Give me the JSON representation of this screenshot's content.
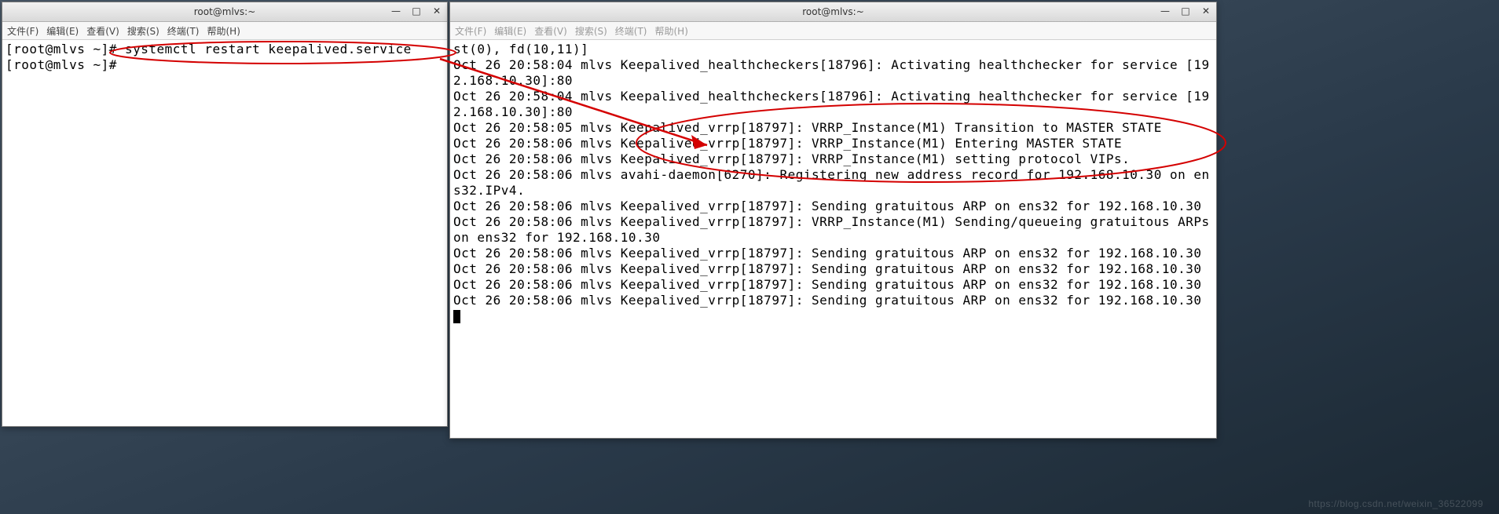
{
  "left_window": {
    "title": "root@mlvs:~",
    "menus": [
      "文件(F)",
      "编辑(E)",
      "查看(V)",
      "搜索(S)",
      "终端(T)",
      "帮助(H)"
    ],
    "lines": [
      "[root@mlvs ~]# systemctl restart keepalived.service",
      "[root@mlvs ~]# "
    ]
  },
  "right_window": {
    "title": "root@mlvs:~",
    "menus": [
      "文件(F)",
      "编辑(E)",
      "查看(V)",
      "搜索(S)",
      "终端(T)",
      "帮助(H)"
    ],
    "lines": [
      "st(0), fd(10,11)]",
      "Oct 26 20:58:04 mlvs Keepalived_healthcheckers[18796]: Activating healthchecker for service [192.168.10.30]:80",
      "Oct 26 20:58:04 mlvs Keepalived_healthcheckers[18796]: Activating healthchecker for service [192.168.10.30]:80",
      "Oct 26 20:58:05 mlvs Keepalived_vrrp[18797]: VRRP_Instance(M1) Transition to MASTER STATE",
      "Oct 26 20:58:06 mlvs Keepalived_vrrp[18797]: VRRP_Instance(M1) Entering MASTER STATE",
      "Oct 26 20:58:06 mlvs Keepalived_vrrp[18797]: VRRP_Instance(M1) setting protocol VIPs.",
      "Oct 26 20:58:06 mlvs avahi-daemon[6270]: Registering new address record for 192.168.10.30 on ens32.IPv4.",
      "Oct 26 20:58:06 mlvs Keepalived_vrrp[18797]: Sending gratuitous ARP on ens32 for 192.168.10.30",
      "Oct 26 20:58:06 mlvs Keepalived_vrrp[18797]: VRRP_Instance(M1) Sending/queueing gratuitous ARPs on ens32 for 192.168.10.30",
      "Oct 26 20:58:06 mlvs Keepalived_vrrp[18797]: Sending gratuitous ARP on ens32 for 192.168.10.30",
      "Oct 26 20:58:06 mlvs Keepalived_vrrp[18797]: Sending gratuitous ARP on ens32 for 192.168.10.30",
      "Oct 26 20:58:06 mlvs Keepalived_vrrp[18797]: Sending gratuitous ARP on ens32 for 192.168.10.30",
      "Oct 26 20:58:06 mlvs Keepalived_vrrp[18797]: Sending gratuitous ARP on ens32 for 192.168.10.30"
    ]
  },
  "watermark": "https://blog.csdn.net/weixin_36522099",
  "annotation": {
    "color": "#d40000"
  }
}
